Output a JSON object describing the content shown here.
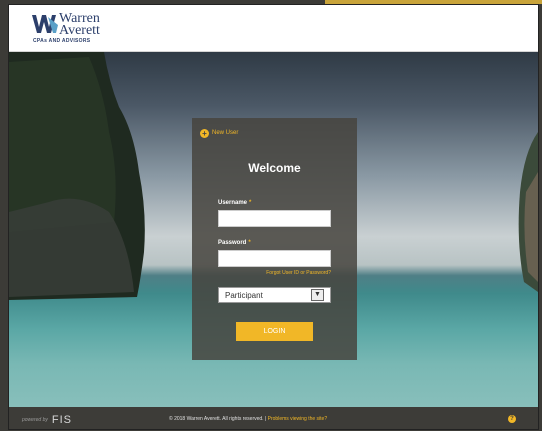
{
  "header": {
    "logo": {
      "name_line1": "Warren",
      "name_line2": "Averett",
      "tagline": "CPAs AND ADVISORS"
    }
  },
  "login": {
    "new_user_label": "New User",
    "welcome": "Welcome",
    "username_label": "Username",
    "username_value": "",
    "password_label": "Password",
    "password_value": "",
    "required_marker": "*",
    "forgot_link": "Forgot User ID or Password?",
    "role_select_value": "Participant",
    "login_button": "LOGIN"
  },
  "footer": {
    "powered_by": "powered by",
    "powered_brand": "FIS",
    "copyright": "© 2018 Warren Averett. All rights reserved. |",
    "problems_link": "Problems viewing the site?",
    "help_glyph": "?"
  },
  "colors": {
    "accent": "#f1b727",
    "panel": "#46443e",
    "footer": "#3d3c38",
    "brand_navy": "#2c3f6b"
  }
}
